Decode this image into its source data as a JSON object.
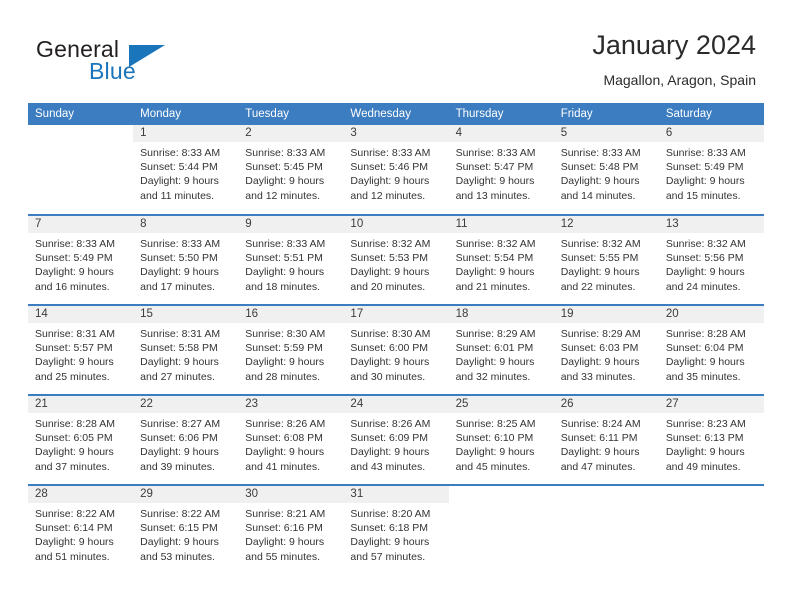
{
  "brand": {
    "name_part1": "General",
    "name_part2": "Blue",
    "logo_icon": "triangle-flag-icon",
    "accent_color": "#1b75bb"
  },
  "header": {
    "title": "January 2024",
    "location": "Magallon, Aragon, Spain"
  },
  "calendar": {
    "header_color": "#3b7dc0",
    "daynum_bg": "#f0f0f0",
    "weekday_headers": [
      "Sunday",
      "Monday",
      "Tuesday",
      "Wednesday",
      "Thursday",
      "Friday",
      "Saturday"
    ],
    "weeks": [
      [
        {
          "day": "",
          "sunrise": "",
          "sunset": "",
          "daylight_line1": "",
          "daylight_line2": "",
          "empty": true
        },
        {
          "day": "1",
          "sunrise": "Sunrise: 8:33 AM",
          "sunset": "Sunset: 5:44 PM",
          "daylight_line1": "Daylight: 9 hours",
          "daylight_line2": "and 11 minutes.",
          "empty": false
        },
        {
          "day": "2",
          "sunrise": "Sunrise: 8:33 AM",
          "sunset": "Sunset: 5:45 PM",
          "daylight_line1": "Daylight: 9 hours",
          "daylight_line2": "and 12 minutes.",
          "empty": false
        },
        {
          "day": "3",
          "sunrise": "Sunrise: 8:33 AM",
          "sunset": "Sunset: 5:46 PM",
          "daylight_line1": "Daylight: 9 hours",
          "daylight_line2": "and 12 minutes.",
          "empty": false
        },
        {
          "day": "4",
          "sunrise": "Sunrise: 8:33 AM",
          "sunset": "Sunset: 5:47 PM",
          "daylight_line1": "Daylight: 9 hours",
          "daylight_line2": "and 13 minutes.",
          "empty": false
        },
        {
          "day": "5",
          "sunrise": "Sunrise: 8:33 AM",
          "sunset": "Sunset: 5:48 PM",
          "daylight_line1": "Daylight: 9 hours",
          "daylight_line2": "and 14 minutes.",
          "empty": false
        },
        {
          "day": "6",
          "sunrise": "Sunrise: 8:33 AM",
          "sunset": "Sunset: 5:49 PM",
          "daylight_line1": "Daylight: 9 hours",
          "daylight_line2": "and 15 minutes.",
          "empty": false
        }
      ],
      [
        {
          "day": "7",
          "sunrise": "Sunrise: 8:33 AM",
          "sunset": "Sunset: 5:49 PM",
          "daylight_line1": "Daylight: 9 hours",
          "daylight_line2": "and 16 minutes.",
          "empty": false
        },
        {
          "day": "8",
          "sunrise": "Sunrise: 8:33 AM",
          "sunset": "Sunset: 5:50 PM",
          "daylight_line1": "Daylight: 9 hours",
          "daylight_line2": "and 17 minutes.",
          "empty": false
        },
        {
          "day": "9",
          "sunrise": "Sunrise: 8:33 AM",
          "sunset": "Sunset: 5:51 PM",
          "daylight_line1": "Daylight: 9 hours",
          "daylight_line2": "and 18 minutes.",
          "empty": false
        },
        {
          "day": "10",
          "sunrise": "Sunrise: 8:32 AM",
          "sunset": "Sunset: 5:53 PM",
          "daylight_line1": "Daylight: 9 hours",
          "daylight_line2": "and 20 minutes.",
          "empty": false
        },
        {
          "day": "11",
          "sunrise": "Sunrise: 8:32 AM",
          "sunset": "Sunset: 5:54 PM",
          "daylight_line1": "Daylight: 9 hours",
          "daylight_line2": "and 21 minutes.",
          "empty": false
        },
        {
          "day": "12",
          "sunrise": "Sunrise: 8:32 AM",
          "sunset": "Sunset: 5:55 PM",
          "daylight_line1": "Daylight: 9 hours",
          "daylight_line2": "and 22 minutes.",
          "empty": false
        },
        {
          "day": "13",
          "sunrise": "Sunrise: 8:32 AM",
          "sunset": "Sunset: 5:56 PM",
          "daylight_line1": "Daylight: 9 hours",
          "daylight_line2": "and 24 minutes.",
          "empty": false
        }
      ],
      [
        {
          "day": "14",
          "sunrise": "Sunrise: 8:31 AM",
          "sunset": "Sunset: 5:57 PM",
          "daylight_line1": "Daylight: 9 hours",
          "daylight_line2": "and 25 minutes.",
          "empty": false
        },
        {
          "day": "15",
          "sunrise": "Sunrise: 8:31 AM",
          "sunset": "Sunset: 5:58 PM",
          "daylight_line1": "Daylight: 9 hours",
          "daylight_line2": "and 27 minutes.",
          "empty": false
        },
        {
          "day": "16",
          "sunrise": "Sunrise: 8:30 AM",
          "sunset": "Sunset: 5:59 PM",
          "daylight_line1": "Daylight: 9 hours",
          "daylight_line2": "and 28 minutes.",
          "empty": false
        },
        {
          "day": "17",
          "sunrise": "Sunrise: 8:30 AM",
          "sunset": "Sunset: 6:00 PM",
          "daylight_line1": "Daylight: 9 hours",
          "daylight_line2": "and 30 minutes.",
          "empty": false
        },
        {
          "day": "18",
          "sunrise": "Sunrise: 8:29 AM",
          "sunset": "Sunset: 6:01 PM",
          "daylight_line1": "Daylight: 9 hours",
          "daylight_line2": "and 32 minutes.",
          "empty": false
        },
        {
          "day": "19",
          "sunrise": "Sunrise: 8:29 AM",
          "sunset": "Sunset: 6:03 PM",
          "daylight_line1": "Daylight: 9 hours",
          "daylight_line2": "and 33 minutes.",
          "empty": false
        },
        {
          "day": "20",
          "sunrise": "Sunrise: 8:28 AM",
          "sunset": "Sunset: 6:04 PM",
          "daylight_line1": "Daylight: 9 hours",
          "daylight_line2": "and 35 minutes.",
          "empty": false
        }
      ],
      [
        {
          "day": "21",
          "sunrise": "Sunrise: 8:28 AM",
          "sunset": "Sunset: 6:05 PM",
          "daylight_line1": "Daylight: 9 hours",
          "daylight_line2": "and 37 minutes.",
          "empty": false
        },
        {
          "day": "22",
          "sunrise": "Sunrise: 8:27 AM",
          "sunset": "Sunset: 6:06 PM",
          "daylight_line1": "Daylight: 9 hours",
          "daylight_line2": "and 39 minutes.",
          "empty": false
        },
        {
          "day": "23",
          "sunrise": "Sunrise: 8:26 AM",
          "sunset": "Sunset: 6:08 PM",
          "daylight_line1": "Daylight: 9 hours",
          "daylight_line2": "and 41 minutes.",
          "empty": false
        },
        {
          "day": "24",
          "sunrise": "Sunrise: 8:26 AM",
          "sunset": "Sunset: 6:09 PM",
          "daylight_line1": "Daylight: 9 hours",
          "daylight_line2": "and 43 minutes.",
          "empty": false
        },
        {
          "day": "25",
          "sunrise": "Sunrise: 8:25 AM",
          "sunset": "Sunset: 6:10 PM",
          "daylight_line1": "Daylight: 9 hours",
          "daylight_line2": "and 45 minutes.",
          "empty": false
        },
        {
          "day": "26",
          "sunrise": "Sunrise: 8:24 AM",
          "sunset": "Sunset: 6:11 PM",
          "daylight_line1": "Daylight: 9 hours",
          "daylight_line2": "and 47 minutes.",
          "empty": false
        },
        {
          "day": "27",
          "sunrise": "Sunrise: 8:23 AM",
          "sunset": "Sunset: 6:13 PM",
          "daylight_line1": "Daylight: 9 hours",
          "daylight_line2": "and 49 minutes.",
          "empty": false
        }
      ],
      [
        {
          "day": "28",
          "sunrise": "Sunrise: 8:22 AM",
          "sunset": "Sunset: 6:14 PM",
          "daylight_line1": "Daylight: 9 hours",
          "daylight_line2": "and 51 minutes.",
          "empty": false
        },
        {
          "day": "29",
          "sunrise": "Sunrise: 8:22 AM",
          "sunset": "Sunset: 6:15 PM",
          "daylight_line1": "Daylight: 9 hours",
          "daylight_line2": "and 53 minutes.",
          "empty": false
        },
        {
          "day": "30",
          "sunrise": "Sunrise: 8:21 AM",
          "sunset": "Sunset: 6:16 PM",
          "daylight_line1": "Daylight: 9 hours",
          "daylight_line2": "and 55 minutes.",
          "empty": false
        },
        {
          "day": "31",
          "sunrise": "Sunrise: 8:20 AM",
          "sunset": "Sunset: 6:18 PM",
          "daylight_line1": "Daylight: 9 hours",
          "daylight_line2": "and 57 minutes.",
          "empty": false
        },
        {
          "day": "",
          "sunrise": "",
          "sunset": "",
          "daylight_line1": "",
          "daylight_line2": "",
          "empty": true
        },
        {
          "day": "",
          "sunrise": "",
          "sunset": "",
          "daylight_line1": "",
          "daylight_line2": "",
          "empty": true
        },
        {
          "day": "",
          "sunrise": "",
          "sunset": "",
          "daylight_line1": "",
          "daylight_line2": "",
          "empty": true
        }
      ]
    ]
  }
}
